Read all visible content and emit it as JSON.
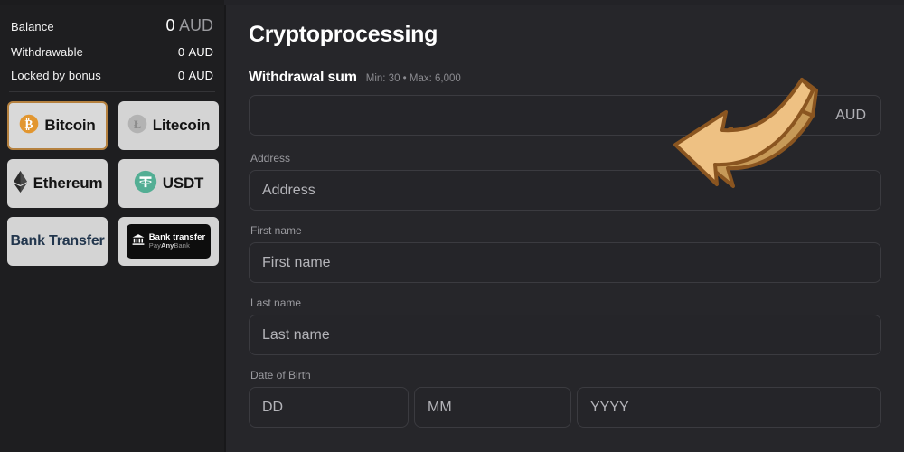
{
  "sidebar": {
    "balances": [
      {
        "label": "Balance",
        "amount": "0",
        "currency": "AUD",
        "primary": true
      },
      {
        "label": "Withdrawable",
        "amount": "0",
        "currency": "AUD",
        "primary": false
      },
      {
        "label": "Locked by bonus",
        "amount": "0",
        "currency": "AUD",
        "primary": false
      }
    ],
    "methods": [
      {
        "label": "Bitcoin",
        "icon": "bitcoin-icon",
        "selected": true
      },
      {
        "label": "Litecoin",
        "icon": "litecoin-icon",
        "selected": false
      },
      {
        "label": "Ethereum",
        "icon": "ethereum-icon",
        "selected": false
      },
      {
        "label": "USDT",
        "icon": "tether-icon",
        "selected": false
      },
      {
        "label": "Bank Transfer",
        "icon": "none",
        "selected": false
      },
      {
        "label": "Bank transfer",
        "sublabel_pre": "Pay",
        "sublabel_mid": "Any",
        "sublabel_post": "Bank",
        "icon": "bank-icon",
        "selected": false
      }
    ]
  },
  "main": {
    "title": "Cryptoprocessing",
    "sum_section": {
      "title": "Withdrawal sum",
      "limits": "Min: 30 • Max: 6,000",
      "currency_suffix": "AUD",
      "amount_value": ""
    },
    "fields": [
      {
        "label": "Address",
        "placeholder": "Address",
        "value": ""
      },
      {
        "label": "First name",
        "placeholder": "First name",
        "value": ""
      },
      {
        "label": "Last name",
        "placeholder": "Last name",
        "value": ""
      }
    ],
    "dob": {
      "label": "Date of Birth",
      "day_placeholder": "DD",
      "month_placeholder": "MM",
      "year_placeholder": "YYYY"
    }
  },
  "annotation": {
    "arrow": "curved-arrow-pointing-down-left",
    "fill": "#eec183",
    "stroke": "#8a5520",
    "shadow": "#c79a58"
  }
}
